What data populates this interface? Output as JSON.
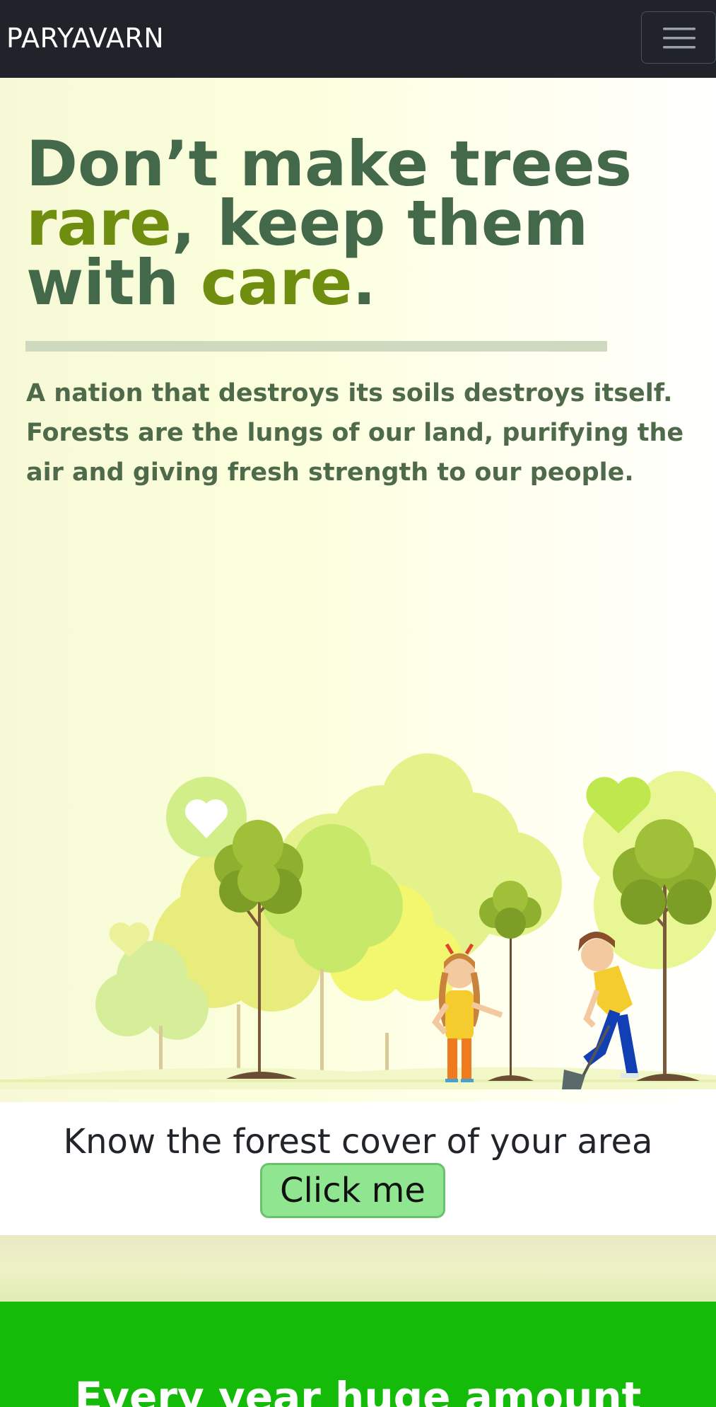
{
  "navbar": {
    "brand": "PARYAVARN",
    "toggler_icon": "hamburger-icon"
  },
  "hero": {
    "headline": {
      "part1": "Don’t make trees ",
      "accent1": "rare",
      "part2": ", keep them with ",
      "accent2": "care",
      "part3": "."
    },
    "lead": "A nation that destroys its soils destroys itself. Forests are the lungs of our land, purifying the air and giving fresh strength to our people.",
    "illustration": "tree-planting-illustration"
  },
  "cta": {
    "text": "Know the forest cover of your area",
    "button_label": "Click me"
  },
  "green_section": {
    "heading": "Every year huge amount"
  },
  "colors": {
    "navbar_bg": "#20242a",
    "headline": "#44694a",
    "accent": "#6f8d0f",
    "button_bg": "#90e690",
    "green_section": "#14bb08"
  }
}
